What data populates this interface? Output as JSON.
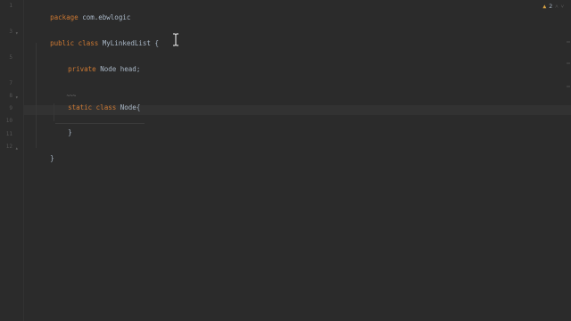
{
  "editor": {
    "lines": [
      {
        "num": "1",
        "parts": [
          {
            "t": "package ",
            "c": "kw"
          },
          {
            "t": "com.ebwlogic",
            "c": "plain"
          }
        ]
      },
      {
        "num": "3",
        "parts": [
          {
            "t": "public class ",
            "c": "kw"
          },
          {
            "t": "MyLinkedList ",
            "c": "cls"
          },
          {
            "t": "{",
            "c": "plain"
          }
        ]
      },
      {
        "num": "5",
        "parts": [
          {
            "t": "private ",
            "c": "kw"
          },
          {
            "t": "Node ",
            "c": "cls"
          },
          {
            "t": "head;",
            "c": "plain"
          }
        ]
      },
      {
        "num": "7",
        "parts": [
          {
            "t": "~~~",
            "c": "comment"
          }
        ]
      },
      {
        "num": "8",
        "parts": [
          {
            "t": "static class ",
            "c": "kw"
          },
          {
            "t": "Node",
            "c": "cls"
          },
          {
            "t": "{",
            "c": "plain"
          }
        ]
      },
      {
        "num": "9",
        "parts": [
          {
            "t": "",
            "c": "plain"
          }
        ]
      },
      {
        "num": "10",
        "parts": [
          {
            "t": "}",
            "c": "plain"
          }
        ]
      },
      {
        "num": "11",
        "parts": [
          {
            "t": "",
            "c": "plain"
          }
        ]
      },
      {
        "num": "12",
        "parts": [
          {
            "t": "}",
            "c": "plain"
          }
        ]
      }
    ]
  },
  "inspection": {
    "warning_icon": "warning-icon",
    "count": "2",
    "up_arrow": "˄",
    "down_arrow": "˅"
  },
  "colors": {
    "background": "#2b2b2b",
    "keyword": "#cc7832",
    "text": "#a9b7c6",
    "comment": "#808080",
    "current_line": "#323232"
  }
}
